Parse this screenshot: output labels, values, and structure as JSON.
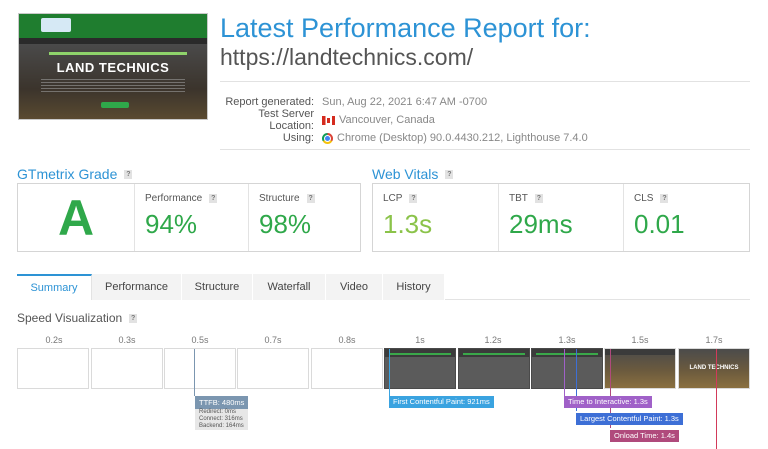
{
  "screenshot": {
    "site_title": "LAND TECHNICS"
  },
  "header": {
    "title": "Latest Performance Report for:",
    "url": "https://landtechnics.com/"
  },
  "meta": {
    "generated_label": "Report generated:",
    "generated_value": "Sun, Aug 22, 2021 6:47 AM -0700",
    "location_label": "Test Server Location:",
    "location_value": "Vancouver, Canada",
    "using_label": "Using:",
    "using_value": "Chrome (Desktop) 90.0.4430.212, Lighthouse 7.4.0"
  },
  "gtmetrix": {
    "heading": "GTmetrix Grade",
    "grade": "A",
    "performance_label": "Performance",
    "performance_value": "94%",
    "structure_label": "Structure",
    "structure_value": "98%"
  },
  "web_vitals": {
    "heading": "Web Vitals",
    "lcp_label": "LCP",
    "lcp_value": "1.3s",
    "tbt_label": "TBT",
    "tbt_value": "29ms",
    "cls_label": "CLS",
    "cls_value": "0.01"
  },
  "tabs": [
    "Summary",
    "Performance",
    "Structure",
    "Waterfall",
    "Video",
    "History"
  ],
  "active_tab": "Summary",
  "speed_viz": {
    "heading": "Speed Visualization",
    "ticks": [
      "0.2s",
      "0.3s",
      "0.5s",
      "0.7s",
      "0.8s",
      "1s",
      "1.2s",
      "1.3s",
      "1.5s",
      "1.7s"
    ],
    "frame_title": "LAND TECHNICS",
    "ttfb": {
      "label": "TTFB: 480ms",
      "redirect": "Redirect: 0ms",
      "connect": "Connect: 316ms",
      "backend": "Backend: 164ms"
    },
    "fcp": "First Contentful Paint: 921ms",
    "tti": "Time to Interactive: 1.3s",
    "lcp": "Largest Contentful Paint: 1.3s",
    "onload": "Onload Time: 1.4s"
  },
  "colors": {
    "accent": "#2d93d5",
    "good": "#2fa84a",
    "ttfb": "#7b96b0",
    "fcp": "#3aa3e0",
    "tti": "#a061c8",
    "lcp": "#3d6fd6",
    "onload": "#b04a7c",
    "fully_loaded": "#d23a5a"
  }
}
